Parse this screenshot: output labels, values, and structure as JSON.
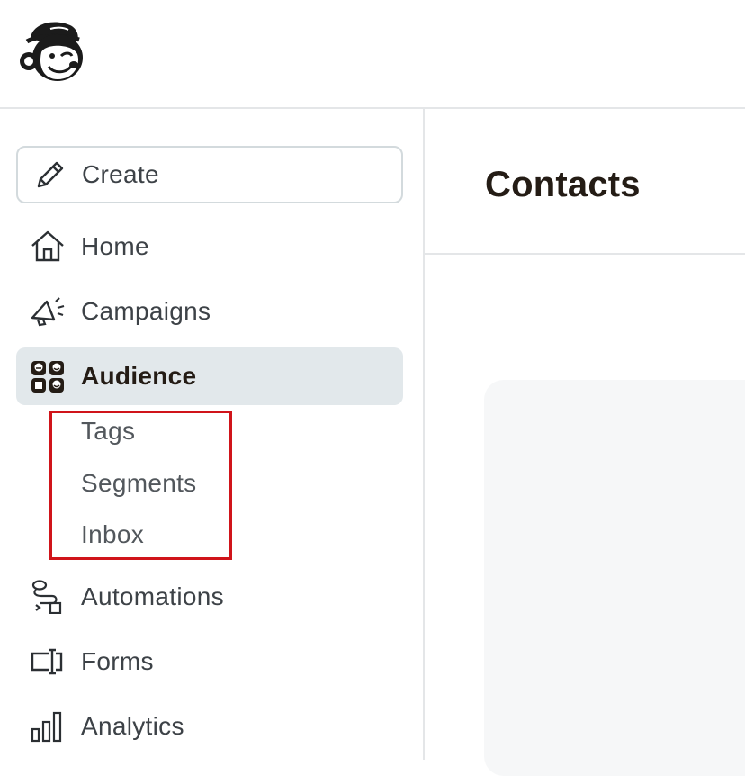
{
  "brand": {
    "logo_icon": "mailchimp-freddie-logo"
  },
  "sidebar": {
    "create": {
      "label": "Create",
      "icon": "pencil-icon"
    },
    "items": [
      {
        "label": "Home",
        "icon": "home-icon"
      },
      {
        "label": "Campaigns",
        "icon": "megaphone-icon"
      },
      {
        "label": "Audience",
        "icon": "audience-icon",
        "active": true
      },
      {
        "label": "Automations",
        "icon": "automations-icon"
      },
      {
        "label": "Forms",
        "icon": "forms-icon"
      },
      {
        "label": "Analytics",
        "icon": "analytics-icon"
      }
    ],
    "audience_subitems": [
      {
        "label": "Tags"
      },
      {
        "label": "Segments"
      },
      {
        "label": "Inbox"
      }
    ]
  },
  "main": {
    "title": "Contacts"
  },
  "colors": {
    "active_bg": "#e2e8eb",
    "highlight": "#d0141a",
    "text_dark": "#241c15",
    "text_nav": "#3d4247"
  }
}
